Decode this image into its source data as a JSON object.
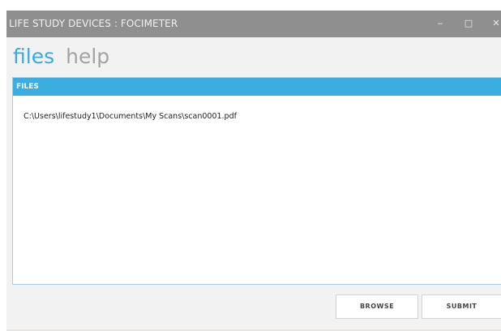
{
  "window": {
    "title": "LIFE STUDY DEVICES : FOCIMETER",
    "minimize_glyph": "‒",
    "maximize_glyph": "□",
    "close_glyph": "✕"
  },
  "nav": {
    "files_label": "files",
    "help_label": "help"
  },
  "files_panel": {
    "header": "FILES",
    "items": [
      "C:\\Users\\lifestudy1\\Documents\\My Scans\\scan0001.pdf"
    ]
  },
  "actions": {
    "browse_label": "BROWSE",
    "submit_label": "SUBMIT"
  },
  "colors": {
    "accent": "#3aaee0",
    "titlebar": "#8f8f8f",
    "nav_active": "#3aa9dc",
    "nav_inactive": "#a3a3a3"
  },
  "icons": {
    "minimize": "minimize-icon",
    "maximize": "maximize-icon",
    "close": "close-icon"
  }
}
